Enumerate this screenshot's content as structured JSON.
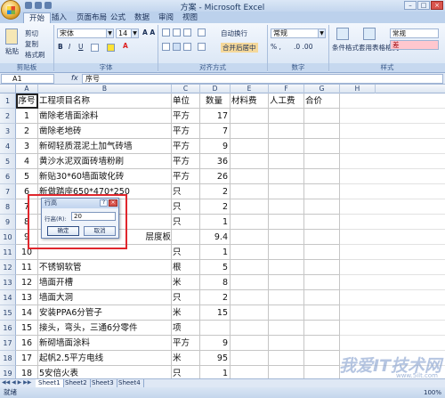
{
  "window": {
    "title": "方案 - Microsoft Excel"
  },
  "ribbon": {
    "tabs": [
      "开始",
      "插入",
      "页面布局",
      "公式",
      "数据",
      "审阅",
      "视图"
    ],
    "clipboard": {
      "paste": "粘贴",
      "cut": "剪切",
      "copy": "复制",
      "format_painter": "格式刷",
      "label": "剪贴板"
    },
    "font": {
      "name": "宋体",
      "size": "14",
      "label": "字体"
    },
    "alignment": {
      "wrap": "自动换行",
      "merge": "合并后居中",
      "label": "对齐方式"
    },
    "number": {
      "format": "常规",
      "label": "数字"
    },
    "styles": {
      "conditional": "条件格式",
      "table": "套用表格格式",
      "normal": "常规",
      "bad": "差",
      "label": "样式"
    }
  },
  "formula_bar": {
    "namebox": "A1",
    "fx": "fx",
    "content": "序号"
  },
  "grid": {
    "columns": [
      "A",
      "B",
      "C",
      "D",
      "E",
      "F",
      "G",
      "H"
    ],
    "header_row": [
      "序号",
      "工程项目名称",
      "单位",
      "数量",
      "材料费",
      "人工费",
      "合价"
    ],
    "rows": [
      {
        "n": "2",
        "a": "1",
        "b": "凿除老墙面涂料",
        "c": "平方",
        "d": "17"
      },
      {
        "n": "3",
        "a": "2",
        "b": "凿除老地砖",
        "c": "平方",
        "d": "7"
      },
      {
        "n": "4",
        "a": "3",
        "b": "新砌轻质混泥土加气砖墙",
        "c": "平方",
        "d": "9"
      },
      {
        "n": "5",
        "a": "4",
        "b": "黄沙水泥双面砖墙粉刷",
        "c": "平方",
        "d": "36"
      },
      {
        "n": "6",
        "a": "5",
        "b": "新贴30*60墙面玻化砖",
        "c": "平方",
        "d": "26"
      },
      {
        "n": "7",
        "a": "6",
        "b": "新做踏座650*470*250",
        "c": "只",
        "d": "2"
      },
      {
        "n": "8",
        "a": "7",
        "b": "",
        "c": "只",
        "d": "2"
      },
      {
        "n": "9",
        "a": "8",
        "b": "",
        "c": "只",
        "d": "1"
      },
      {
        "n": "10",
        "a": "9",
        "b": "",
        "c": "",
        "d": "9.4"
      },
      {
        "n": "11",
        "a": "10",
        "b": "",
        "c": "只",
        "d": "1"
      },
      {
        "n": "12",
        "a": "11",
        "b": "不锈钢软管",
        "c": "根",
        "d": "5"
      },
      {
        "n": "13",
        "a": "12",
        "b": "墙面开槽",
        "c": "米",
        "d": "8"
      },
      {
        "n": "14",
        "a": "13",
        "b": "墙面大洞",
        "c": "只",
        "d": "2"
      },
      {
        "n": "15",
        "a": "14",
        "b": "安装PPA6分管子",
        "c": "米",
        "d": "15"
      },
      {
        "n": "16",
        "a": "15",
        "b": "接头，弯头，三通6分零件",
        "c": "项",
        "d": ""
      },
      {
        "n": "17",
        "a": "16",
        "b": "新砌墙面涂料",
        "c": "平方",
        "d": "9"
      },
      {
        "n": "18",
        "a": "17",
        "b": "起帆2.5平方电线",
        "c": "米",
        "d": "95"
      },
      {
        "n": "19",
        "a": "18",
        "b": "5安倍火表",
        "c": "只",
        "d": "1"
      },
      {
        "n": "20",
        "a": "19",
        "b": "漏电开关",
        "c": "只",
        "d": "1"
      }
    ],
    "partial_row_b10": "层度板"
  },
  "dialog": {
    "title": "行高",
    "help": "?",
    "close": "×",
    "label": "行高(R):",
    "value": "20",
    "ok": "确定",
    "cancel": "取消"
  },
  "sheets": [
    "Sheet1",
    "Sheet2",
    "Sheet3",
    "Sheet4"
  ],
  "status": {
    "text": "就绪",
    "zoom": "100%"
  },
  "watermark": {
    "main": "我爱IT技术网",
    "sub": "www.5ilt.com"
  },
  "colors": {
    "accent": "#1a2f56",
    "highlight": "#e0262c"
  }
}
